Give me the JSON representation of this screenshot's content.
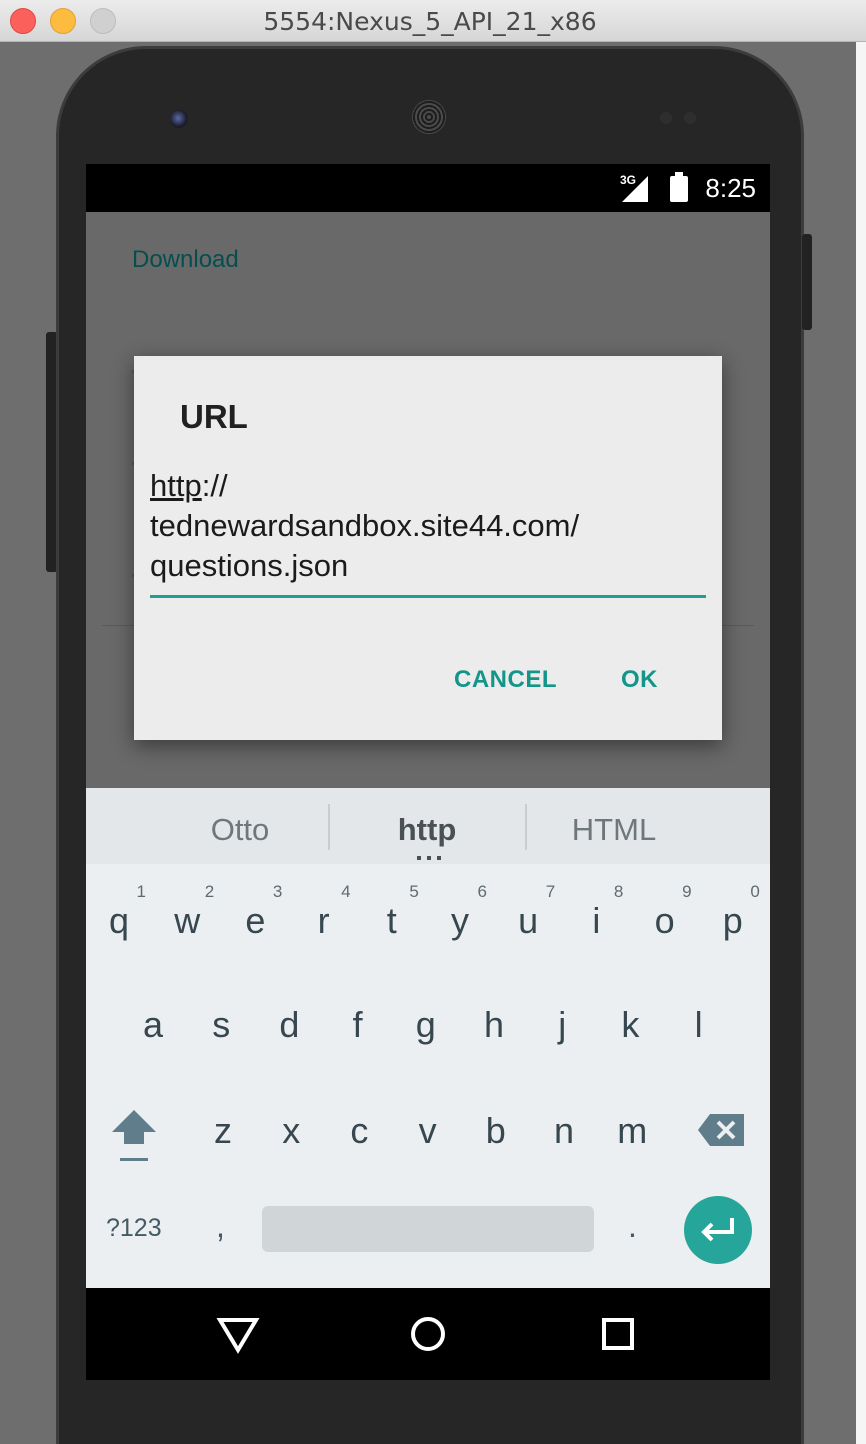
{
  "window": {
    "title": "5554:Nexus_5_API_21_x86"
  },
  "status_bar": {
    "network": "3G",
    "time": "8:25"
  },
  "app": {
    "title": "Download"
  },
  "dialog": {
    "title": "URL",
    "url_scheme": "http",
    "url_rest": "://\ntednewardsandbox.site44.com/\nquestions.json",
    "cancel_label": "CANCEL",
    "ok_label": "OK"
  },
  "keyboard": {
    "suggestions": [
      "Otto",
      "http",
      "HTML"
    ],
    "row1": [
      {
        "letter": "q",
        "hint": "1"
      },
      {
        "letter": "w",
        "hint": "2"
      },
      {
        "letter": "e",
        "hint": "3"
      },
      {
        "letter": "r",
        "hint": "4"
      },
      {
        "letter": "t",
        "hint": "5"
      },
      {
        "letter": "y",
        "hint": "6"
      },
      {
        "letter": "u",
        "hint": "7"
      },
      {
        "letter": "i",
        "hint": "8"
      },
      {
        "letter": "o",
        "hint": "9"
      },
      {
        "letter": "p",
        "hint": "0"
      }
    ],
    "row2": [
      "a",
      "s",
      "d",
      "f",
      "g",
      "h",
      "j",
      "k",
      "l"
    ],
    "row3": [
      "z",
      "x",
      "c",
      "v",
      "b",
      "n",
      "m"
    ],
    "symbols_label": "?123",
    "comma_label": ",",
    "period_label": ".",
    "icons": {
      "shift": "shift-icon",
      "delete": "backspace-icon",
      "enter": "enter-icon"
    },
    "accent_color": "#26a69a"
  },
  "nav_bar": {
    "icons": [
      "back-icon",
      "home-icon",
      "recents-icon"
    ]
  }
}
